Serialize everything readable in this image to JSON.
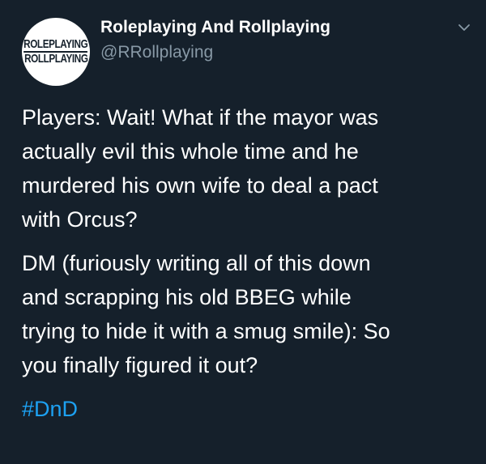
{
  "account": {
    "avatar_text_top": "ROLEPLAYING",
    "avatar_text_bottom": "ROLLPLAYING",
    "display_name": "Roleplaying And Rollplaying",
    "handle": "@RRollplaying"
  },
  "tweet": {
    "paragraph_1": "Players: Wait! What if the mayor was\nactually evil this whole time and he\nmurdered his own wife to deal a pact\nwith Orcus?",
    "paragraph_2": "DM (furiously writing all of this down\nand scrapping his old BBEG while\ntrying to hide it with a smug smile): So\nyou finally figured it out?",
    "hashtag": "#DnD"
  },
  "icons": {
    "menu": "chevron-down-icon"
  },
  "colors": {
    "background": "#15202b",
    "text": "#ffffff",
    "secondary_text": "#8899a6",
    "link": "#1da1f2"
  }
}
